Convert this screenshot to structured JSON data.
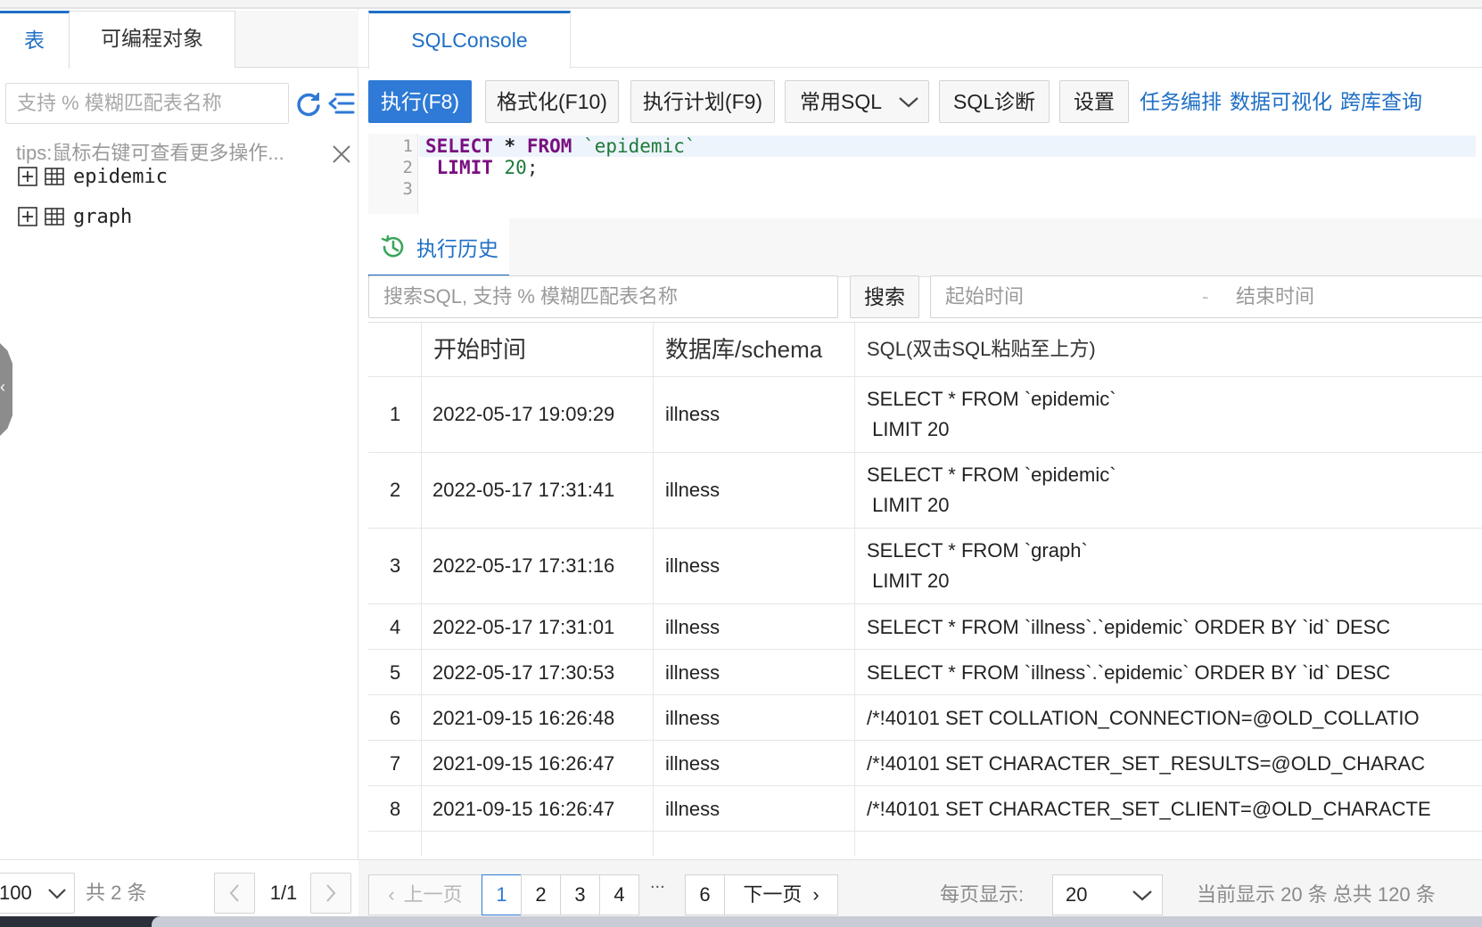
{
  "left_panel": {
    "tabs": [
      {
        "label": "表",
        "active": true
      },
      {
        "label": "可编程对象",
        "active": false
      }
    ],
    "search_placeholder": "支持 % 模糊匹配表名称",
    "tips": "tips:鼠标右键可查看更多操作...",
    "tables": [
      {
        "name": "epidemic"
      },
      {
        "name": "graph"
      }
    ],
    "footer": {
      "page_size": "100",
      "total": "共 2 条",
      "page": "1/1"
    }
  },
  "console": {
    "tab_label": "SQLConsole",
    "toolbar": {
      "run": "执行(F8)",
      "format": "格式化(F10)",
      "plan": "执行计划(F9)",
      "common_sql": "常用SQL",
      "diagnose": "SQL诊断",
      "settings": "设置",
      "links": [
        "任务编排",
        "数据可视化",
        "跨库查询"
      ]
    },
    "editor": {
      "line_numbers": [
        "1",
        "2",
        "3"
      ]
    }
  },
  "history": {
    "tab_label": "执行历史",
    "search_placeholder": "搜索SQL, 支持 % 模糊匹配表名称",
    "search_button": "搜索",
    "start_time_placeholder": "起始时间",
    "date_separator": "-",
    "end_time_placeholder": "结束时间",
    "columns": [
      "开始时间",
      "数据库/schema",
      "SQL(双击SQL粘贴至上方)"
    ],
    "rows": [
      {
        "index": "1",
        "time": "2022-05-17 19:09:29",
        "db": "illness",
        "sql": "SELECT * FROM `epidemic`\n LIMIT 20"
      },
      {
        "index": "2",
        "time": "2022-05-17 17:31:41",
        "db": "illness",
        "sql": "SELECT * FROM `epidemic`\n LIMIT 20"
      },
      {
        "index": "3",
        "time": "2022-05-17 17:31:16",
        "db": "illness",
        "sql": "SELECT * FROM `graph`\n LIMIT 20"
      },
      {
        "index": "4",
        "time": "2022-05-17 17:31:01",
        "db": "illness",
        "sql": "SELECT * FROM `illness`.`epidemic` ORDER BY `id` DESC"
      },
      {
        "index": "5",
        "time": "2022-05-17 17:30:53",
        "db": "illness",
        "sql": "SELECT * FROM `illness`.`epidemic` ORDER BY `id` DESC"
      },
      {
        "index": "6",
        "time": "2021-09-15 16:26:48",
        "db": "illness",
        "sql": "/*!40101 SET COLLATION_CONNECTION=@OLD_COLLATIO"
      },
      {
        "index": "7",
        "time": "2021-09-15 16:26:47",
        "db": "illness",
        "sql": "/*!40101 SET CHARACTER_SET_RESULTS=@OLD_CHARAC"
      },
      {
        "index": "8",
        "time": "2021-09-15 16:26:47",
        "db": "illness",
        "sql": "/*!40101 SET CHARACTER_SET_CLIENT=@OLD_CHARACTE"
      }
    ],
    "pagination": {
      "prev": "上一页",
      "pages": [
        "1",
        "2",
        "3",
        "4"
      ],
      "ellipsis": "...",
      "last_page": "6",
      "next": "下一页",
      "current": "1",
      "per_page_label": "每页显示:",
      "per_page": "20",
      "summary": "当前显示 20 条 总共 120 条"
    }
  },
  "colors": {
    "accent": "#1f6fc5",
    "primary_button": "#2e7ad6",
    "keyword": "#7a0f7f",
    "string": "#1d7a3a"
  }
}
